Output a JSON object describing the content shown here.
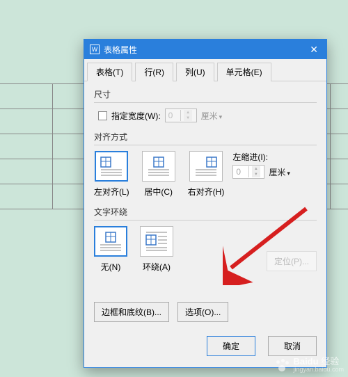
{
  "dialog": {
    "title": "表格属性",
    "close": "✕",
    "tabs": [
      {
        "label": "表格(T)",
        "active": true
      },
      {
        "label": "行(R)",
        "active": false
      },
      {
        "label": "列(U)",
        "active": false
      },
      {
        "label": "单元格(E)",
        "active": false
      }
    ],
    "size": {
      "group_label": "尺寸",
      "checkbox_label": "指定宽度(W):",
      "width_value": "0",
      "unit": "厘米",
      "enabled": false
    },
    "align": {
      "group_label": "对齐方式",
      "options": [
        {
          "label": "左对齐(L)",
          "selected": true
        },
        {
          "label": "居中(C)",
          "selected": false
        },
        {
          "label": "右对齐(H)",
          "selected": false
        }
      ],
      "indent_label": "左缩进(I):",
      "indent_value": "0",
      "indent_unit": "厘米"
    },
    "wrap": {
      "group_label": "文字环绕",
      "options": [
        {
          "label": "无(N)",
          "selected": true
        },
        {
          "label": "环绕(A)",
          "selected": false
        }
      ],
      "position_btn": "定位(P)...",
      "position_enabled": false
    },
    "buttons": {
      "border": "边框和底纹(B)...",
      "options": "选项(O)...",
      "ok": "确定",
      "cancel": "取消"
    }
  },
  "watermark": {
    "brand": "Baidu",
    "sub": "jingyan.baidu.com",
    "cn": "经验"
  }
}
